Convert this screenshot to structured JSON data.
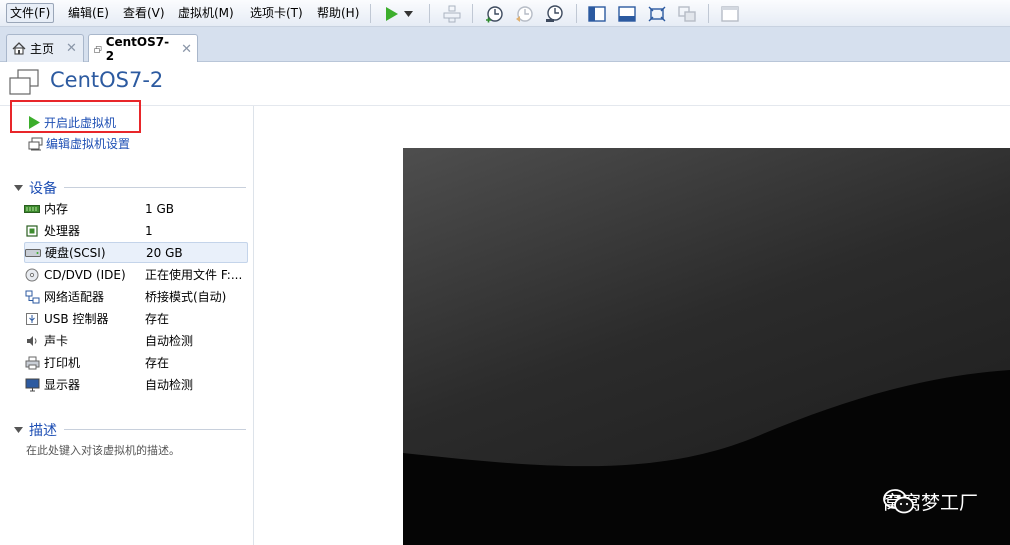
{
  "menu": {
    "items": [
      "文件(F)",
      "编辑(E)",
      "查看(V)",
      "虚拟机(M)",
      "选项卡(T)",
      "帮助(H)"
    ]
  },
  "toolbar": {
    "icons": [
      "play-icon",
      "dropdown-arrow-icon",
      "send-keys-icon",
      "snapshot-take-icon",
      "snapshot-revert-icon",
      "snapshot-manager-icon",
      "sidebar-toggle-icon",
      "console-view-icon",
      "fullscreen-icon",
      "unity-icon",
      "thumbnail-icon"
    ]
  },
  "tabs": [
    {
      "label": "主页",
      "icon": "home-icon"
    },
    {
      "label": "CentOS7-2",
      "icon": "vm-icon"
    }
  ],
  "header": {
    "title": "CentOS7-2"
  },
  "commands": {
    "power_on": "开启此虚拟机",
    "edit_settings": "编辑虚拟机设置"
  },
  "devices": {
    "heading": "设备",
    "items": [
      {
        "name": "内存",
        "value": "1 GB",
        "icon": "memory-icon"
      },
      {
        "name": "处理器",
        "value": "1",
        "icon": "cpu-icon"
      },
      {
        "name": "硬盘(SCSI)",
        "value": "20 GB",
        "icon": "harddisk-icon"
      },
      {
        "name": "CD/DVD (IDE)",
        "value": "正在使用文件 F:...",
        "icon": "cdrom-icon"
      },
      {
        "name": "网络适配器",
        "value": "桥接模式(自动)",
        "icon": "network-icon"
      },
      {
        "name": "USB 控制器",
        "value": "存在",
        "icon": "usb-icon"
      },
      {
        "name": "声卡",
        "value": "自动检测",
        "icon": "sound-icon"
      },
      {
        "name": "打印机",
        "value": "存在",
        "icon": "printer-icon"
      },
      {
        "name": "显示器",
        "value": "自动检测",
        "icon": "monitor-icon"
      }
    ]
  },
  "description": {
    "heading": "描述",
    "placeholder": "在此处键入对该虚拟机的描述。"
  },
  "watermark": {
    "text": "窝窝梦工厂"
  },
  "colors": {
    "accent": "#1e4fb4",
    "highlight": "#e8262a",
    "play": "#3cae2c"
  }
}
